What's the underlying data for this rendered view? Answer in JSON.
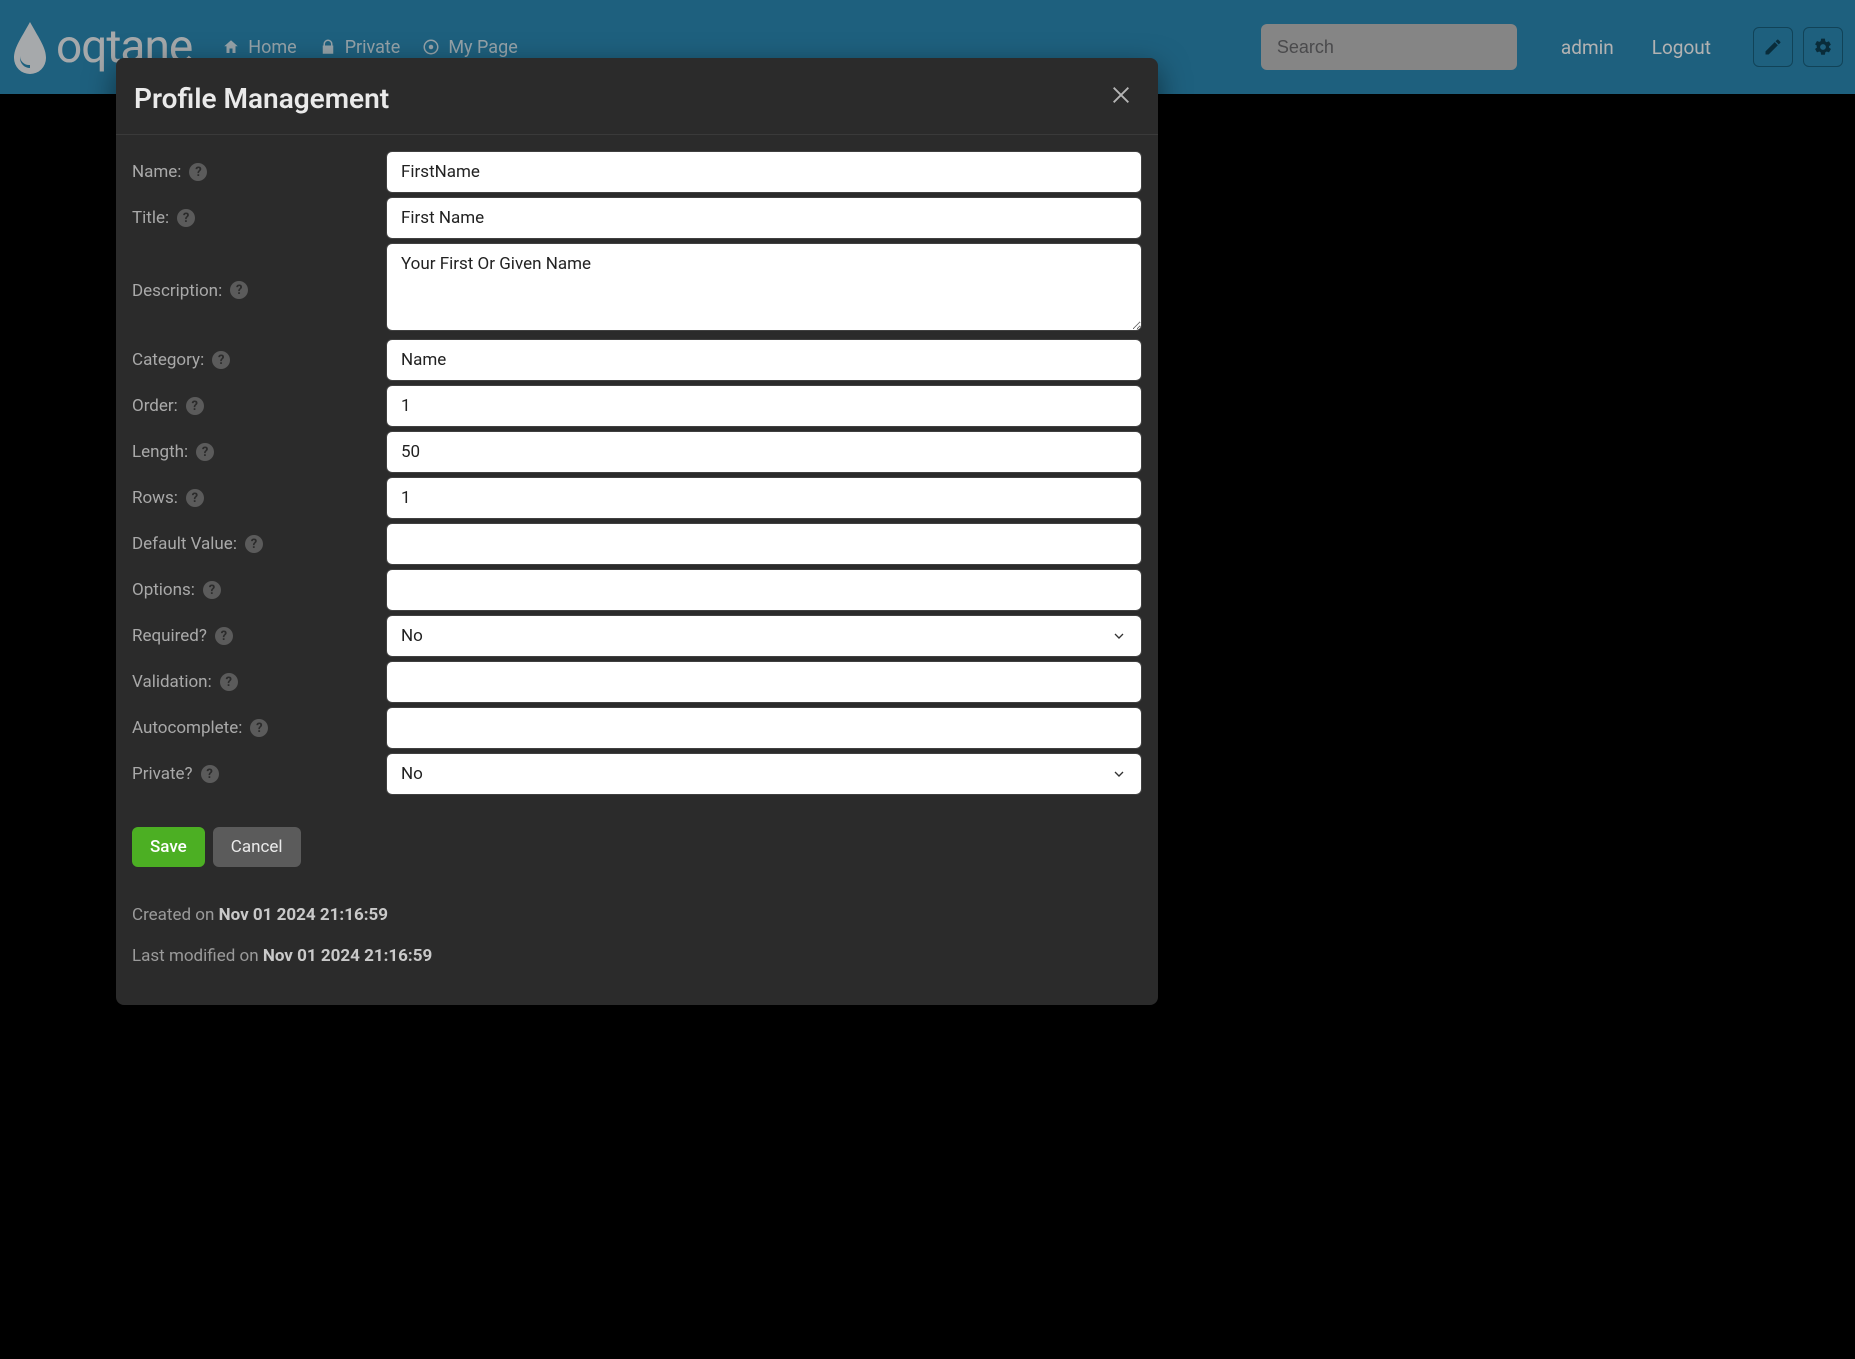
{
  "brand": "oqtane",
  "nav": {
    "home": "Home",
    "private": "Private",
    "mypage": "My Page"
  },
  "search": {
    "placeholder": "Search"
  },
  "user": {
    "name": "admin",
    "logout": "Logout"
  },
  "modal": {
    "title": "Profile Management",
    "labels": {
      "name": "Name:",
      "title": "Title:",
      "description": "Description:",
      "category": "Category:",
      "order": "Order:",
      "length": "Length:",
      "rows": "Rows:",
      "default": "Default Value:",
      "options": "Options:",
      "required": "Required?",
      "validation": "Validation:",
      "autocomplete": "Autocomplete:",
      "private": "Private?"
    },
    "values": {
      "name": "FirstName",
      "title": "First Name",
      "description": "Your First Or Given Name",
      "category": "Name",
      "order": "1",
      "length": "50",
      "rows": "1",
      "default": "",
      "options": "",
      "required": "No",
      "validation": "",
      "autocomplete": "",
      "private": "No"
    },
    "buttons": {
      "save": "Save",
      "cancel": "Cancel"
    },
    "meta": {
      "created_prefix": "Created on ",
      "created_date": "Nov 01 2024 21:16:59",
      "modified_prefix": "Last modified on ",
      "modified_date": "Nov 01 2024 21:16:59"
    }
  }
}
